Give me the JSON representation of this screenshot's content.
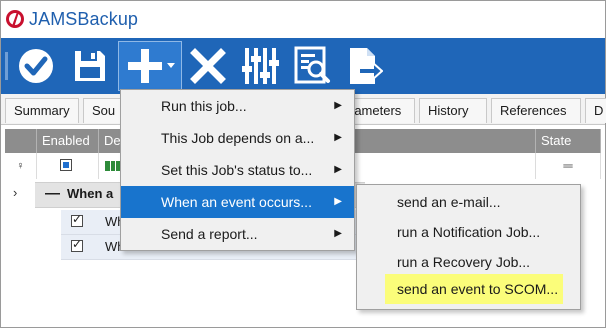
{
  "window": {
    "title": "JAMSBackup"
  },
  "toolbar": {
    "buttons": [
      {
        "icon": "checkmark-icon"
      },
      {
        "icon": "save-icon"
      },
      {
        "icon": "add-icon",
        "dropdown": true
      },
      {
        "icon": "delete-icon"
      },
      {
        "icon": "properties-sliders-icon"
      },
      {
        "icon": "report-icon"
      },
      {
        "icon": "export-icon"
      }
    ],
    "color": "#1f66b8"
  },
  "tabs": [
    "Summary",
    "Sou",
    "rameters",
    "History",
    "References",
    "D"
  ],
  "grid": {
    "headers": {
      "enabled": "Enabled",
      "desc": "De",
      "state": "State"
    },
    "row1": {
      "pin": "♀",
      "state": "═"
    },
    "group": {
      "label": "When a"
    },
    "subrows": [
      "Wh",
      "When an event occurs send an e-mail with"
    ]
  },
  "menu": {
    "items": [
      {
        "label": "Run this job...",
        "has_submenu": true
      },
      {
        "label": "This Job depends on a...",
        "has_submenu": true
      },
      {
        "label": "Set this Job's status to...",
        "has_submenu": true
      },
      {
        "label": "When an event occurs...",
        "has_submenu": true,
        "highlighted": true
      },
      {
        "label": "Send a report...",
        "has_submenu": true
      }
    ]
  },
  "submenu": {
    "items": [
      {
        "label": "send an e-mail..."
      },
      {
        "label": "run a Notification Job..."
      },
      {
        "label": "run a Recovery Job..."
      },
      {
        "label": "send an event to SCOM...",
        "highlighted": true
      }
    ]
  },
  "colors": {
    "highlight_blue": "#1874cd",
    "scom_highlight": "#fbfd7a"
  }
}
